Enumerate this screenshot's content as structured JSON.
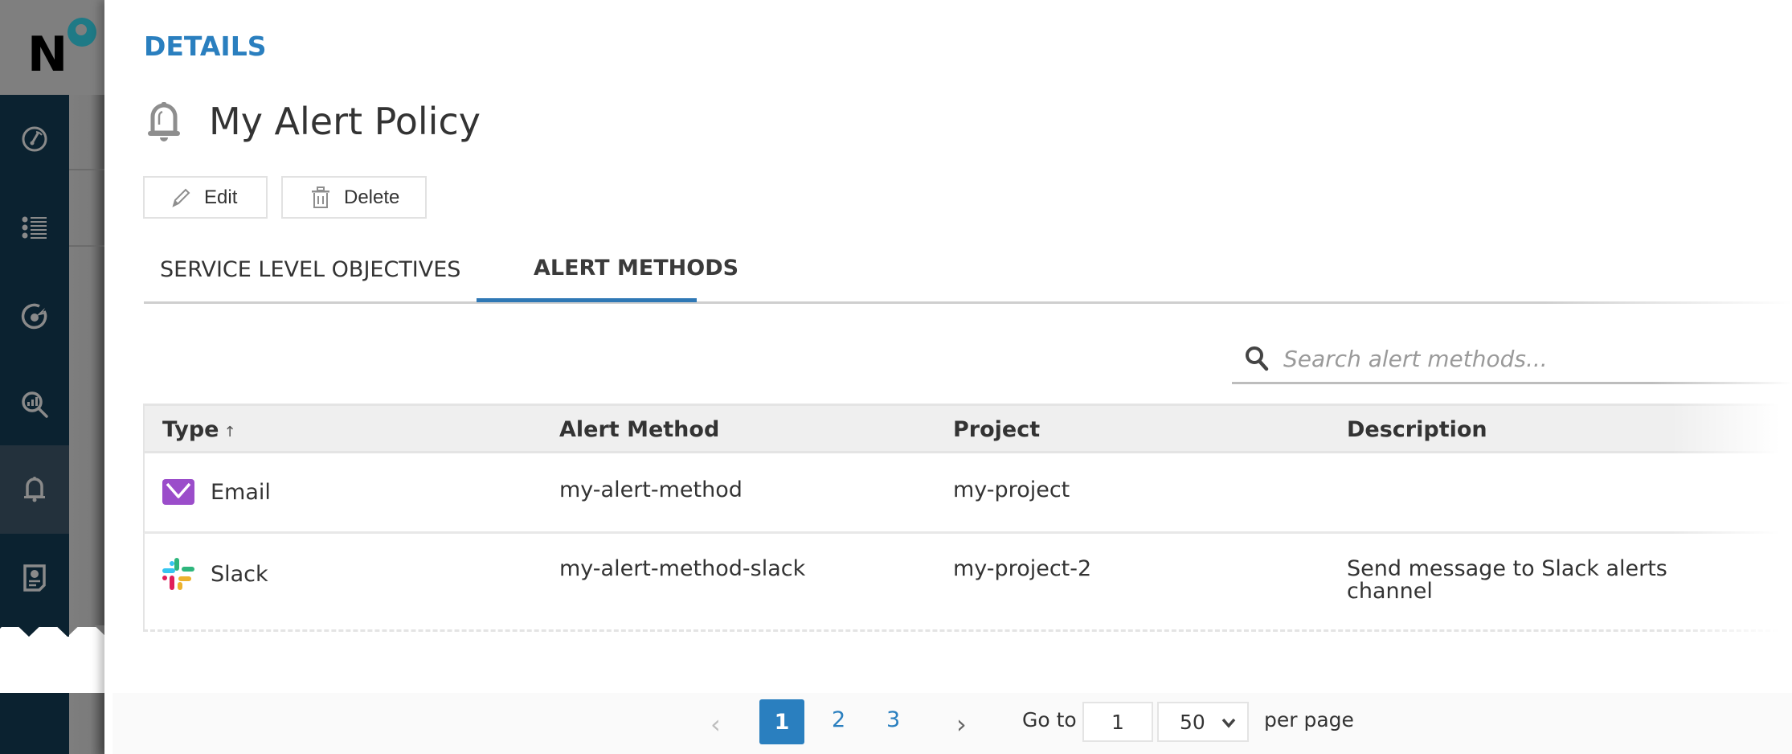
{
  "app": {
    "logo_letter": "N",
    "sidebar": {
      "items": [
        {
          "name": "dashboard",
          "icon": "speedometer-icon",
          "active": false
        },
        {
          "name": "list",
          "icon": "list-icon",
          "active": false
        },
        {
          "name": "slo",
          "icon": "target-icon",
          "active": false
        },
        {
          "name": "analysis",
          "icon": "magnify-chart-icon",
          "active": false
        },
        {
          "name": "alerts",
          "icon": "bell-icon",
          "active": true
        },
        {
          "name": "reports",
          "icon": "report-icon",
          "active": false
        }
      ]
    }
  },
  "details": {
    "section_label": "DETAILS",
    "title": "My Alert Policy",
    "title_icon": "bell-icon",
    "buttons": {
      "edit": "Edit",
      "delete": "Delete"
    },
    "tabs": [
      {
        "label": "SERVICE LEVEL OBJECTIVES",
        "active": false
      },
      {
        "label": "ALERT METHODS",
        "active": true
      }
    ],
    "search": {
      "placeholder": "Search alert methods...",
      "value": ""
    },
    "table": {
      "columns": [
        "Type",
        "Alert Method",
        "Project",
        "Description"
      ],
      "sort": {
        "column": "Type",
        "direction": "↑"
      },
      "rows": [
        {
          "type": "Email",
          "type_icon": "email-icon",
          "alert_method": "my-alert-method",
          "project": "my-project",
          "description": ""
        },
        {
          "type": "Slack",
          "type_icon": "slack-icon",
          "alert_method": "my-alert-method-slack",
          "project": "my-project-2",
          "description": "Send message to Slack alerts channel"
        }
      ]
    },
    "pagination": {
      "prev": "‹",
      "pages": [
        "1",
        "2",
        "3"
      ],
      "current_page": "1",
      "next": "›",
      "goto_label": "Go to",
      "goto_value": "1",
      "per_page_value": "50",
      "per_page_label": "per page"
    },
    "colors": {
      "accent": "#2a7fbf",
      "sidebar": "#0b2230",
      "email_icon": "#9b4dca"
    }
  }
}
